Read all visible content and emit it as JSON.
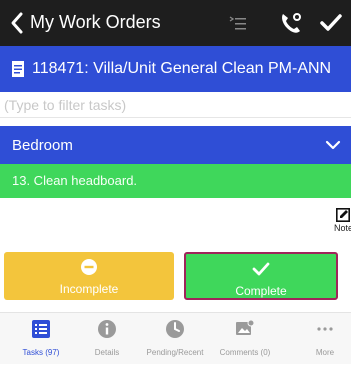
{
  "header": {
    "title": "My Work Orders",
    "icons": [
      "back-chevron-icon",
      "list-icon",
      "phone-icon",
      "checkmark-icon"
    ]
  },
  "work_order": {
    "text": "118471: Villa/Unit General Clean PM-ANN",
    "icon": "document-icon"
  },
  "filter": {
    "placeholder": "(Type to filter tasks)",
    "value": ""
  },
  "section": {
    "label": "Bedroom",
    "icon": "chevron-down-icon"
  },
  "task": {
    "label": "13. Clean headboard."
  },
  "notes": {
    "label": "Note",
    "icon": "edit-note-icon"
  },
  "actions": {
    "incomplete": {
      "label": "Incomplete",
      "icon": "minus-circle-icon"
    },
    "complete": {
      "label": "Complete",
      "icon": "checkmark-icon"
    }
  },
  "tabs": [
    {
      "label": "Tasks (97)",
      "icon": "tasks-list-icon",
      "active": true
    },
    {
      "label": "Details",
      "icon": "info-icon",
      "active": false
    },
    {
      "label": "Pending/Recent",
      "icon": "clock-icon",
      "active": false
    },
    {
      "label": "Comments (0)",
      "icon": "photo-comment-icon",
      "active": false
    },
    {
      "label": "More",
      "icon": "more-dots-icon",
      "active": false
    }
  ],
  "colors": {
    "header_bg": "#1e1e1e",
    "accent_blue": "#2f4ed6",
    "task_green": "#3fd75b",
    "incomplete_yellow": "#f3c53c",
    "selected_border": "#a0245a"
  }
}
